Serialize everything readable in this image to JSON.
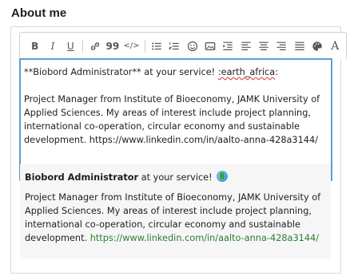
{
  "section": {
    "title": "About me"
  },
  "toolbar": {
    "buttons": [
      {
        "name": "bold",
        "label": "B"
      },
      {
        "name": "italic",
        "label": "I"
      },
      {
        "name": "underline",
        "label": "U"
      },
      {
        "name": "link",
        "icon": "link-icon"
      },
      {
        "name": "quote",
        "label": "99"
      },
      {
        "name": "code",
        "label": "</>"
      },
      {
        "name": "bulleted-list",
        "icon": "bulleted-list-icon"
      },
      {
        "name": "numbered-list",
        "icon": "numbered-list-icon"
      },
      {
        "name": "emoji",
        "icon": "smiley-icon"
      },
      {
        "name": "image",
        "icon": "image-icon"
      },
      {
        "name": "indent",
        "icon": "indent-icon"
      },
      {
        "name": "align-left",
        "icon": "align-left-icon"
      },
      {
        "name": "align-center",
        "icon": "align-center-icon"
      },
      {
        "name": "align-right",
        "icon": "align-right-icon"
      },
      {
        "name": "align-justify",
        "icon": "align-justify-icon"
      },
      {
        "name": "color",
        "icon": "palette-icon"
      },
      {
        "name": "font",
        "label": "A"
      }
    ]
  },
  "editor": {
    "line1_pre": "**Biobord Administrator** at your service! ",
    "line1_emoji_code": ":earth_africa",
    "line1_post": ":",
    "paragraph": "Project Manager from Institute of Bioeconomy, JAMK University of Applied Sciences. My areas of interest include project planning, international co-operation, circular economy and sustainable development. https://www.linkedin.com/in/aalto-anna-428a3144/"
  },
  "preview": {
    "strong": "Biobord Administrator",
    "after_strong": " at your service!",
    "paragraph": "Project Manager from Institute of Bioeconomy, JAMK University of Applied Sciences. My areas of interest include project planning, international co-operation, circular economy and sustainable development.",
    "link": "https://www.linkedin.com/in/aalto-anna-428a3144/"
  },
  "colors": {
    "focus_border": "#5a9ed8",
    "link": "#2e7d32",
    "preview_bg": "#f6f6f6"
  }
}
